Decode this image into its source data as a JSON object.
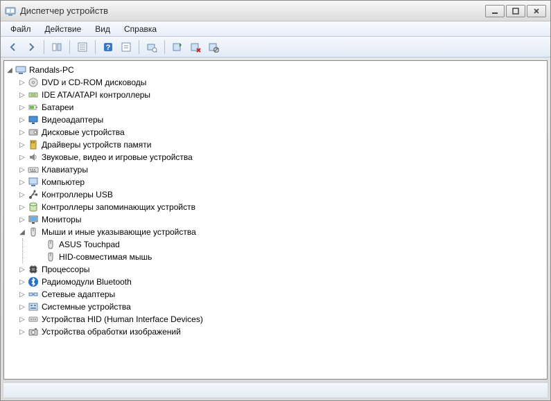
{
  "window": {
    "title": "Диспетчер устройств"
  },
  "menu": {
    "file": "Файл",
    "action": "Действие",
    "view": "Вид",
    "help": "Справка"
  },
  "root": {
    "label": "Randals-PC"
  },
  "categories": [
    {
      "label": "DVD и CD-ROM дисководы",
      "icon": "cd"
    },
    {
      "label": "IDE ATA/ATAPI контроллеры",
      "icon": "ide"
    },
    {
      "label": "Батареи",
      "icon": "battery"
    },
    {
      "label": "Видеоадаптеры",
      "icon": "display"
    },
    {
      "label": "Дисковые устройства",
      "icon": "disk"
    },
    {
      "label": "Драйверы устройств памяти",
      "icon": "sd"
    },
    {
      "label": "Звуковые, видео и игровые устройства",
      "icon": "sound"
    },
    {
      "label": "Клавиатуры",
      "icon": "keyboard"
    },
    {
      "label": "Компьютер",
      "icon": "computer"
    },
    {
      "label": "Контроллеры USB",
      "icon": "usb"
    },
    {
      "label": "Контроллеры запоминающих устройств",
      "icon": "storage"
    },
    {
      "label": "Мониторы",
      "icon": "monitor"
    },
    {
      "label": "Мыши и иные указывающие устройства",
      "icon": "mouse",
      "expanded": true,
      "children": [
        {
          "label": "ASUS Touchpad",
          "icon": "mouse"
        },
        {
          "label": "HID-совместимая мышь",
          "icon": "mouse"
        }
      ]
    },
    {
      "label": "Процессоры",
      "icon": "cpu"
    },
    {
      "label": "Радиомодули Bluetooth",
      "icon": "bluetooth"
    },
    {
      "label": "Сетевые адаптеры",
      "icon": "network"
    },
    {
      "label": "Системные устройства",
      "icon": "system"
    },
    {
      "label": "Устройства HID (Human Interface Devices)",
      "icon": "hid"
    },
    {
      "label": "Устройства обработки изображений",
      "icon": "imaging"
    }
  ],
  "colors": {
    "accent": "#3a79c4"
  }
}
